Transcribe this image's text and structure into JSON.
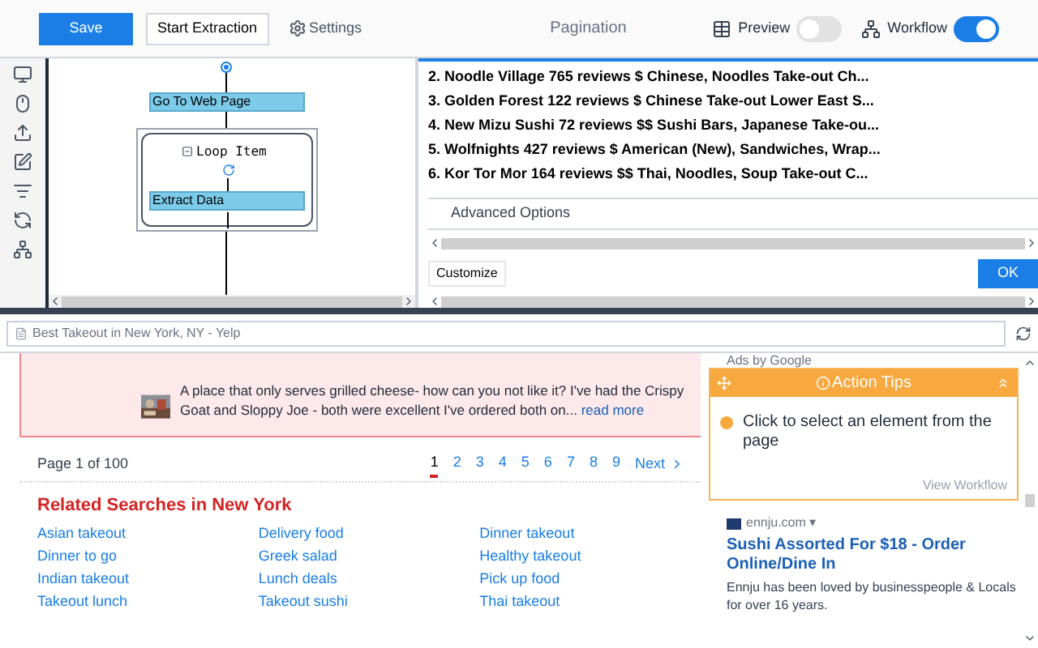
{
  "toolbar": {
    "save": "Save",
    "start": "Start Extraction",
    "settings": "Settings",
    "title": "Pagination",
    "preview": {
      "label": "Preview",
      "on": false
    },
    "workflow": {
      "label": "Workflow",
      "on": true
    }
  },
  "workflow": {
    "steps": [
      {
        "kind": "action",
        "label": "Go To Web Page"
      },
      {
        "kind": "loop",
        "label": "Loop Item",
        "children": [
          {
            "kind": "action",
            "label": "Extract Data"
          }
        ]
      }
    ]
  },
  "results": {
    "rows": [
      "2. Noodle Village 765 reviews $ Chinese, Noodles Take-out Ch...",
      "3. Golden Forest 122 reviews $ Chinese Take-out Lower East S...",
      "4. New Mizu Sushi 72 reviews $$ Sushi Bars, Japanese Take-ou...",
      "5. Wolfnights 427 reviews $ American (New), Sandwiches, Wrap...",
      "6. Kor Tor Mor 164 reviews $$ Thai, Noodles, Soup Take-out C..."
    ],
    "advanced": "Advanced Options",
    "customize": "Customize",
    "ok": "OK"
  },
  "browser": {
    "page_title": "Best Takeout in New York, NY - Yelp"
  },
  "review": {
    "text": "A place that only serves grilled cheese- how can you not like it? I've had the Crispy Goat and Sloppy Joe - both were excellent  I've ordered both on...",
    "link": "read more"
  },
  "pagination": {
    "summary": "Page 1 of 100",
    "pages": [
      {
        "label": "1",
        "selected": true
      },
      {
        "label": "2",
        "selected": false
      },
      {
        "label": "3",
        "selected": false
      },
      {
        "label": "4",
        "selected": false
      },
      {
        "label": "5",
        "selected": false
      },
      {
        "label": "6",
        "selected": false
      },
      {
        "label": "7",
        "selected": false
      },
      {
        "label": "8",
        "selected": false
      },
      {
        "label": "9",
        "selected": false
      }
    ],
    "next": "Next"
  },
  "related": {
    "heading": "Related Searches in New York",
    "links": [
      "Asian takeout",
      "Delivery food",
      "Dinner takeout",
      "Dinner to go",
      "Greek salad",
      "Healthy takeout",
      "Indian takeout",
      "Lunch deals",
      "Pick up food",
      "Takeout lunch",
      "Takeout sushi",
      "Thai takeout"
    ]
  },
  "ads": {
    "label": "Ads by Google",
    "domain": "ennju.com ▾",
    "title": "Sushi Assorted For $18 - Order Online/Dine In",
    "description": "Ennju has been loved by businesspeople & Locals for over 16 years."
  },
  "action_tips": {
    "title": "Action Tips",
    "message": "Click to select an element from the page",
    "link": "View Workflow"
  }
}
